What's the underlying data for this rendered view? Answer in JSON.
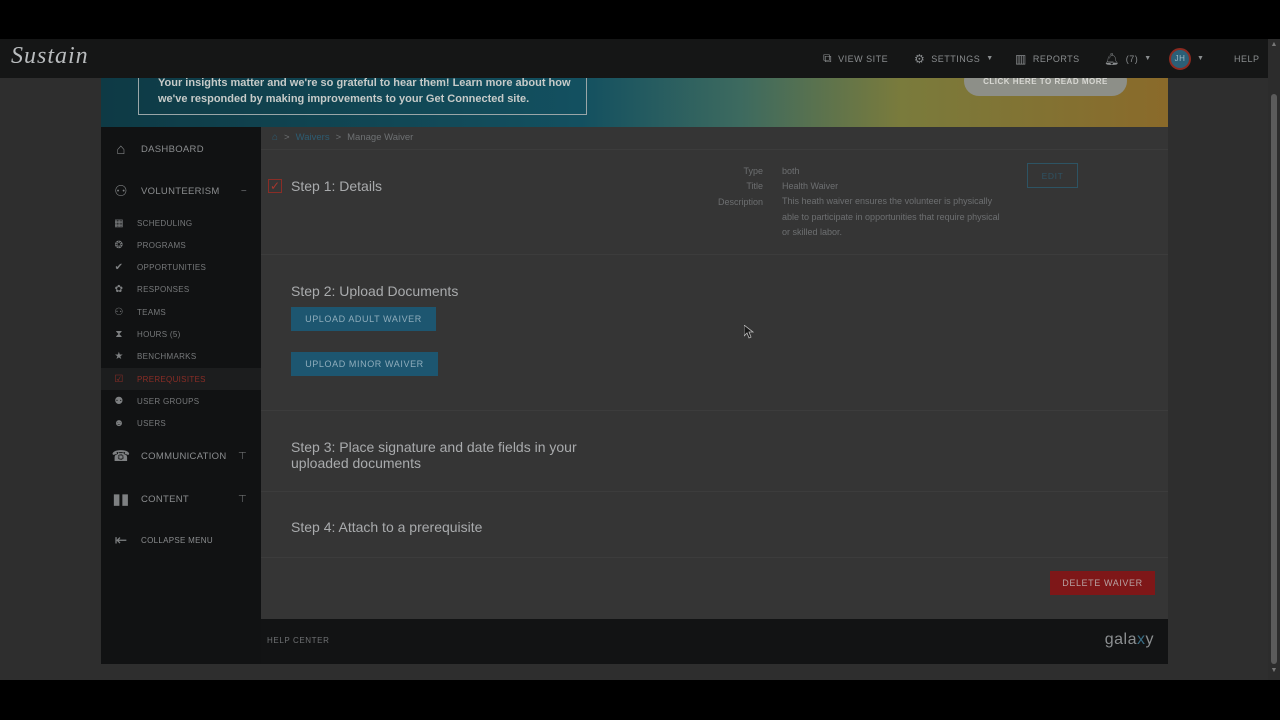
{
  "app": {
    "brand": "Sustain"
  },
  "topnav": {
    "view_site": "VIEW SITE",
    "settings": "SETTINGS",
    "reports": "REPORTS",
    "notifications": "(7)",
    "avatar_initials": "JH",
    "help": "HELP"
  },
  "banner": {
    "text": "Your insights matter and we're so grateful to hear them! Learn more about how we've responded by making improvements to your Get Connected site.",
    "cta": "CLICK HERE TO READ MORE"
  },
  "sidebar": {
    "dashboard": "DASHBOARD",
    "volunteerism": "VOLUNTEERISM",
    "volunteerism_toggle": "−",
    "items": [
      {
        "label": "SCHEDULING",
        "icon": "calendar-icon"
      },
      {
        "label": "PROGRAMS",
        "icon": "programs-icon"
      },
      {
        "label": "OPPORTUNITIES",
        "icon": "opportunities-icon"
      },
      {
        "label": "RESPONSES",
        "icon": "responses-icon"
      },
      {
        "label": "TEAMS",
        "icon": "teams-icon"
      },
      {
        "label": "HOURS  (5)",
        "icon": "hourglass-icon"
      },
      {
        "label": "BENCHMARKS",
        "icon": "star-icon"
      },
      {
        "label": "PREREQUISITES",
        "icon": "checkbox-icon",
        "active": true
      },
      {
        "label": "USER GROUPS",
        "icon": "user-groups-icon"
      },
      {
        "label": "USERS",
        "icon": "user-icon"
      }
    ],
    "communication": "COMMUNICATION",
    "content": "CONTENT",
    "collapse": "COLLAPSE MENU"
  },
  "breadcrumb": {
    "link": "Waivers",
    "sep": ">",
    "current": "Manage Waiver"
  },
  "step1": {
    "title": "Step 1: Details",
    "type_label": "Type",
    "type_value": "both",
    "title_label": "Title",
    "title_value": "Health Waiver",
    "description_label": "Description",
    "description_value": "This heath waiver ensures the volunteer is physically able to participate in opportunities that require physical or skilled labor.",
    "edit": "EDIT"
  },
  "step2": {
    "title": "Step 2: Upload Documents",
    "upload_adult": "UPLOAD ADULT WAIVER",
    "upload_minor": "UPLOAD MINOR WAIVER"
  },
  "step3": {
    "title": "Step 3: Place signature and date fields in your uploaded documents"
  },
  "step4": {
    "title": "Step 4: Attach to a prerequisite"
  },
  "actions": {
    "delete": "DELETE WAIVER"
  },
  "footer": {
    "help_center": "HELP CENTER",
    "logo_pre": "gala",
    "logo_x": "x",
    "logo_post": "y"
  },
  "colors": {
    "accent_blue": "#1d5670",
    "danger": "#7e1718",
    "active_red": "#8a2d26"
  }
}
